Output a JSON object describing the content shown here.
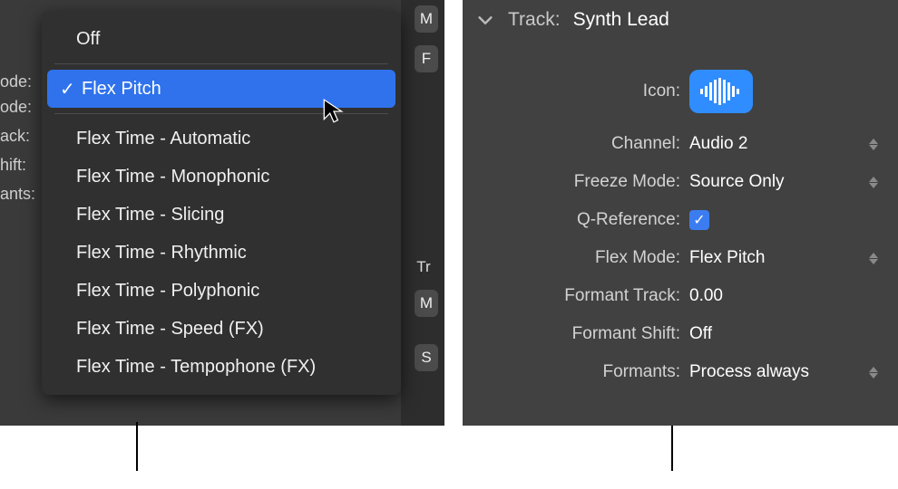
{
  "menu": {
    "off": "Off",
    "flex_pitch": "Flex Pitch",
    "items": [
      "Flex Time - Automatic",
      "Flex Time - Monophonic",
      "Flex Time - Slicing",
      "Flex Time - Rhythmic",
      "Flex Time - Polyphonic",
      "Flex Time - Speed (FX)",
      "Flex Time - Tempophone (FX)"
    ]
  },
  "obscured": {
    "r1": "ode:",
    "r2": "ode:",
    "r3": "ack:",
    "r4": "hift:",
    "r5": "ants:"
  },
  "frag": {
    "m": "M",
    "f": "F",
    "tr": "Tr",
    "m2": "M",
    "s": "S"
  },
  "inspector": {
    "header_label": "Track:",
    "header_name": "Synth Lead",
    "icon_label": "Icon:",
    "icon_name": "waveform-icon",
    "channel_label": "Channel:",
    "channel_value": "Audio 2",
    "freeze_label": "Freeze Mode:",
    "freeze_value": "Source Only",
    "qref_label": "Q-Reference:",
    "qref_checked": true,
    "flex_label": "Flex Mode:",
    "flex_value": "Flex Pitch",
    "ftrack_label": "Formant Track:",
    "ftrack_value": "0.00",
    "fshift_label": "Formant Shift:",
    "fshift_value": "Off",
    "formants_label": "Formants:",
    "formants_value": "Process always"
  },
  "colors": {
    "accent": "#2f8dff",
    "menu_highlight": "#2f72ec"
  }
}
